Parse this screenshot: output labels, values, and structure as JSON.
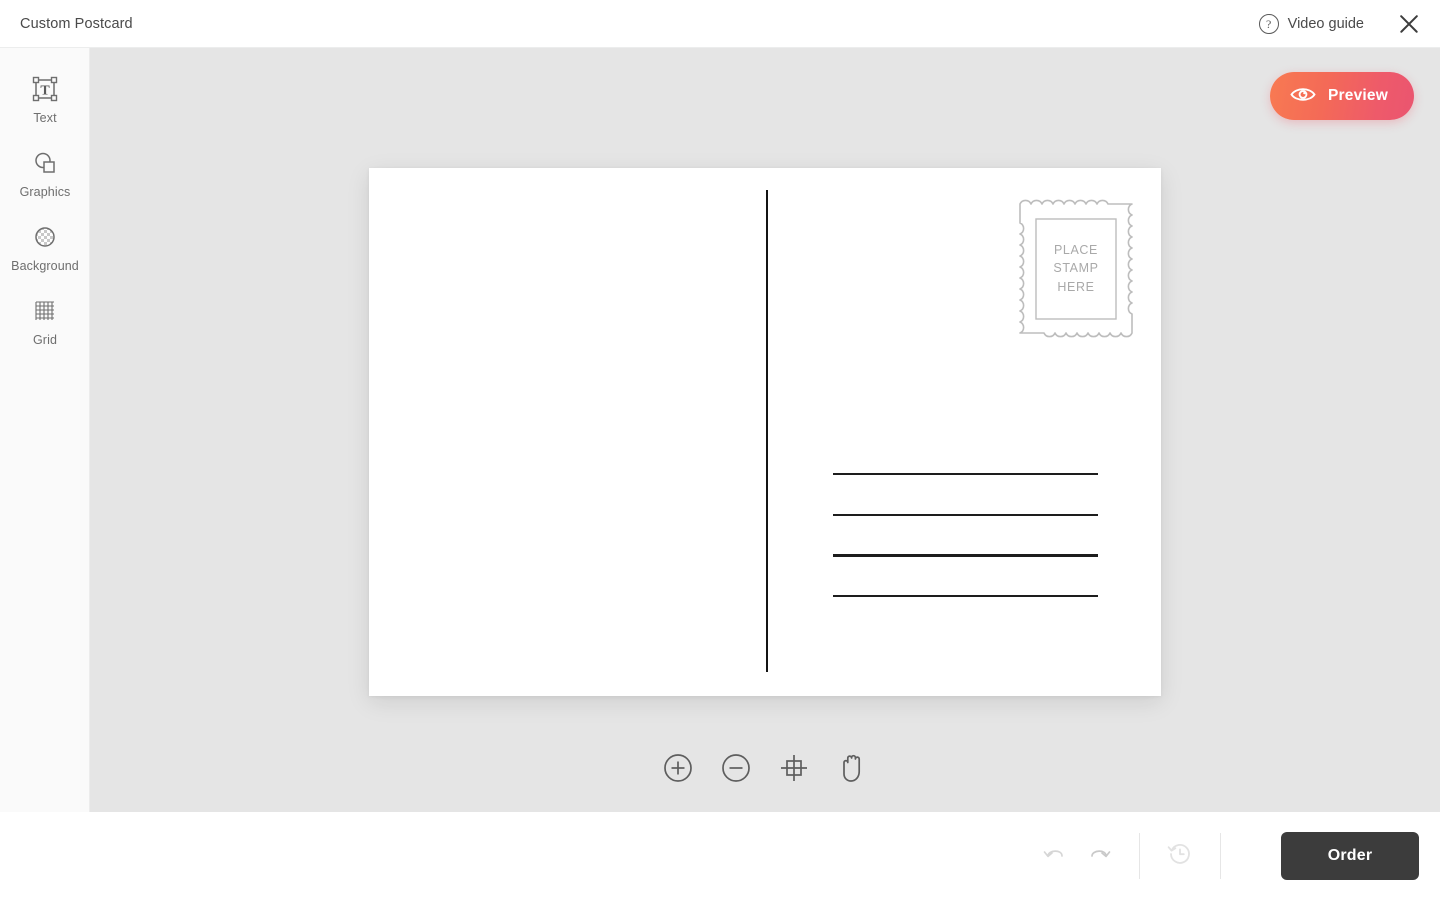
{
  "header": {
    "title": "Custom Postcard",
    "video_guide_label": "Video guide",
    "help_icon": "question-mark-icon",
    "close_icon": "close-icon"
  },
  "sidebar": {
    "items": [
      {
        "label": "Text",
        "icon": "text-frame-icon"
      },
      {
        "label": "Graphics",
        "icon": "shapes-icon"
      },
      {
        "label": "Background",
        "icon": "checker-circle-icon"
      },
      {
        "label": "Grid",
        "icon": "grid-icon"
      }
    ]
  },
  "canvas": {
    "preview_button": {
      "label": "Preview",
      "icon": "eye-icon"
    },
    "postcard": {
      "stamp_text_lines": [
        "PLACE",
        "STAMP",
        "HERE"
      ],
      "address_line_count": 4
    },
    "tools": [
      {
        "name": "zoom-in",
        "icon": "plus-circle-icon"
      },
      {
        "name": "zoom-out",
        "icon": "minus-circle-icon"
      },
      {
        "name": "fit-to-screen",
        "icon": "crop-frame-icon"
      },
      {
        "name": "pan",
        "icon": "hand-icon"
      }
    ]
  },
  "footer": {
    "undo": {
      "name": "undo",
      "icon": "undo-arrow-icon",
      "enabled": false
    },
    "redo": {
      "name": "redo",
      "icon": "redo-arrow-icon",
      "enabled": false
    },
    "history": {
      "name": "history",
      "icon": "clock-revert-icon",
      "enabled": false
    },
    "order_button": {
      "label": "Order"
    }
  },
  "colors": {
    "accent_start": "#f87a52",
    "accent_end": "#ea5570",
    "order_button": "#3c3c3c",
    "canvas_background": "#e5e5e5",
    "sidebar_background": "#fafafa"
  }
}
